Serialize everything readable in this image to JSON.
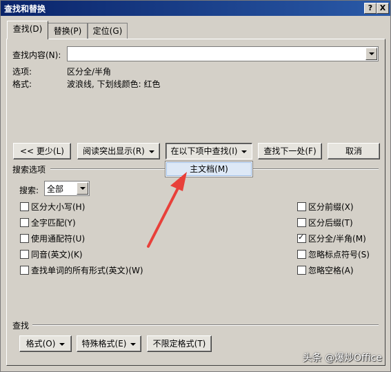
{
  "window": {
    "title": "查找和替换",
    "help_label": "?",
    "close_label": "X"
  },
  "tabs": [
    {
      "label": "查找(D)"
    },
    {
      "label": "替换(P)"
    },
    {
      "label": "定位(G)"
    }
  ],
  "find": {
    "label": "查找内容(N):",
    "value": ""
  },
  "options_row": {
    "label": "选项:",
    "value": "区分全/半角"
  },
  "format_row": {
    "label": "格式:",
    "value": "波浪线, 下划线颜色: 红色"
  },
  "buttons": {
    "less": "<< 更少(L)",
    "reading_highlight": "阅读突出显示(R)",
    "find_in": "在以下项中查找(I)",
    "find_next": "查找下一处(F)",
    "cancel": "取消"
  },
  "find_in_menu": {
    "item": "主文档(M)"
  },
  "search_options": {
    "section_label": "搜索选项",
    "search_label": "搜索:",
    "search_value": "全部",
    "left_checks": [
      {
        "label": "区分大小写(H)",
        "checked": false
      },
      {
        "label": "全字匹配(Y)",
        "checked": false
      },
      {
        "label": "使用通配符(U)",
        "checked": false
      },
      {
        "label": "同音(英文)(K)",
        "checked": false
      },
      {
        "label": "查找单词的所有形式(英文)(W)",
        "checked": false
      }
    ],
    "right_checks": [
      {
        "label": "区分前缀(X)",
        "checked": false
      },
      {
        "label": "区分后缀(T)",
        "checked": false
      },
      {
        "label": "区分全/半角(M)",
        "checked": true
      },
      {
        "label": "忽略标点符号(S)",
        "checked": false
      },
      {
        "label": "忽略空格(A)",
        "checked": false
      }
    ]
  },
  "bottom": {
    "section_label": "查找",
    "format_button": "格式(O)",
    "special_button": "特殊格式(E)",
    "no_format_button": "不限定格式(T)"
  },
  "watermark": "头条 @爆炒Office",
  "colors": {
    "arrow": "#e8403a",
    "title_bar": "#0a246a",
    "highlight": "#dde8f6"
  }
}
